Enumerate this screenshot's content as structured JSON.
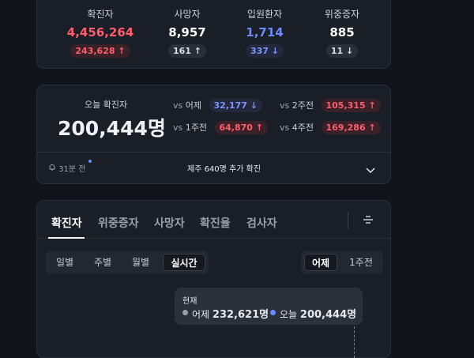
{
  "stats": [
    {
      "label": "확진자",
      "value": "4,456,264",
      "value_color": "red",
      "delta": "243,628",
      "delta_dir": "up",
      "badge": "red"
    },
    {
      "label": "사망자",
      "value": "8,957",
      "value_color": "white",
      "delta": "161",
      "delta_dir": "up",
      "badge": "gray"
    },
    {
      "label": "입원환자",
      "value": "1,714",
      "value_color": "blue",
      "delta": "337",
      "delta_dir": "down",
      "badge": "blue"
    },
    {
      "label": "위중증자",
      "value": "885",
      "value_color": "white",
      "delta": "11",
      "delta_dir": "down",
      "badge": "gray"
    }
  ],
  "today": {
    "label": "오늘 확진자",
    "value": "200,444명",
    "comparisons": [
      {
        "vs": "vs",
        "label": "어제",
        "value": "32,177",
        "dir": "down"
      },
      {
        "vs": "vs",
        "label": "2주전",
        "value": "105,315",
        "dir": "up"
      },
      {
        "vs": "vs",
        "label": "1주전",
        "value": "64,870",
        "dir": "up"
      },
      {
        "vs": "vs",
        "label": "4주전",
        "value": "169,286",
        "dir": "up"
      }
    ],
    "update_time": "31분 전",
    "message": "제주 640명 추가 확진"
  },
  "chart": {
    "tabs": [
      "확진자",
      "위중증자",
      "사망자",
      "확진율",
      "검사자"
    ],
    "periods": [
      "일별",
      "주별",
      "월별",
      "실시간"
    ],
    "compare": [
      "어제",
      "1주전"
    ],
    "tooltip": {
      "title": "현재",
      "yesterday_label": "어제",
      "yesterday_value": "232,621명",
      "today_label": "오늘",
      "today_value": "200,444명"
    }
  },
  "icons": {
    "up": "arrow-up-icon",
    "down": "arrow-down-icon",
    "bell": "bell-icon",
    "chevron": "chevron-down-icon",
    "filter": "filter-icon"
  },
  "colors": {
    "red": "#ff5d6e",
    "blue": "#6b8cff",
    "background": "#11141b",
    "card": "#1a1e27"
  }
}
